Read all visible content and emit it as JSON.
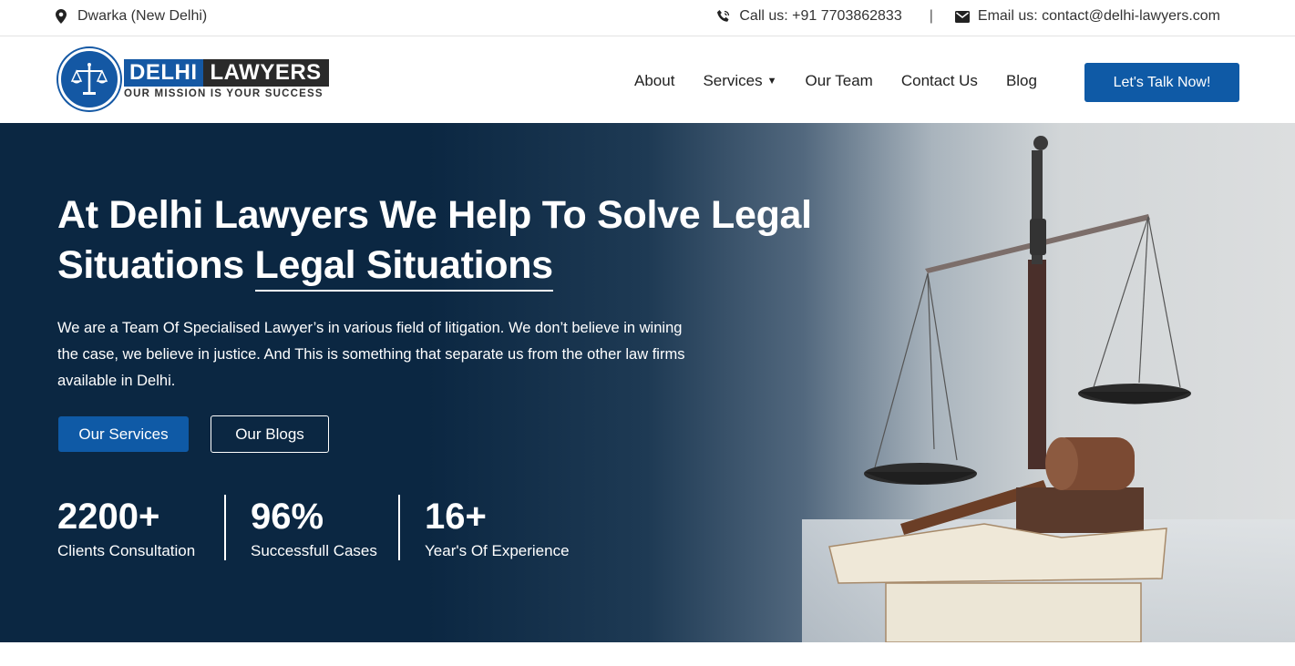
{
  "topbar": {
    "location": "Dwarka (New Delhi)",
    "location_icon": "map-pin-icon",
    "phone_label": "Call us: +91 7703862833",
    "phone_icon": "phone-icon",
    "separator": "|",
    "email_label": "Email us: contact@delhi-lawyers.com",
    "email_icon": "envelope-icon"
  },
  "header": {
    "logo": {
      "word1": "DELHI",
      "word2": "LAWYERS",
      "tagline": "OUR MISSION IS YOUR SUCCESS",
      "emblem_icon": "scales-of-justice-icon"
    },
    "nav": [
      {
        "label": "About"
      },
      {
        "label": "Services",
        "has_dropdown": true,
        "dropdown_icon": "caret-down-icon"
      },
      {
        "label": "Our Team"
      },
      {
        "label": "Contact Us"
      },
      {
        "label": "Blog"
      }
    ],
    "cta_label": "Let's Talk Now!"
  },
  "hero": {
    "title_line1": "At Delhi Lawyers We Help To Solve Legal",
    "title_line2_plain": "Situations ",
    "title_line2_underlined": "Legal Situations",
    "description": "We are a Team Of Specialised Lawyer’s in various field of litigation. We don’t believe in wining the case, we believe in justice. And This is something that separate us from the other law firms available in Delhi.",
    "primary_button": "Our Services",
    "secondary_button": "Our Blogs",
    "stats": [
      {
        "value": "2200+",
        "label": "Clients Consultation"
      },
      {
        "value": "96%",
        "label": "Successfull Cases"
      },
      {
        "value": "16+",
        "label": "Year's Of Experience"
      }
    ],
    "image_subject": "scales-of-justice-gavel-books-photo"
  },
  "colors": {
    "brand_blue": "#0f5aa6",
    "hero_navy": "#0b2742",
    "logo_dark": "#2a2a2a"
  }
}
